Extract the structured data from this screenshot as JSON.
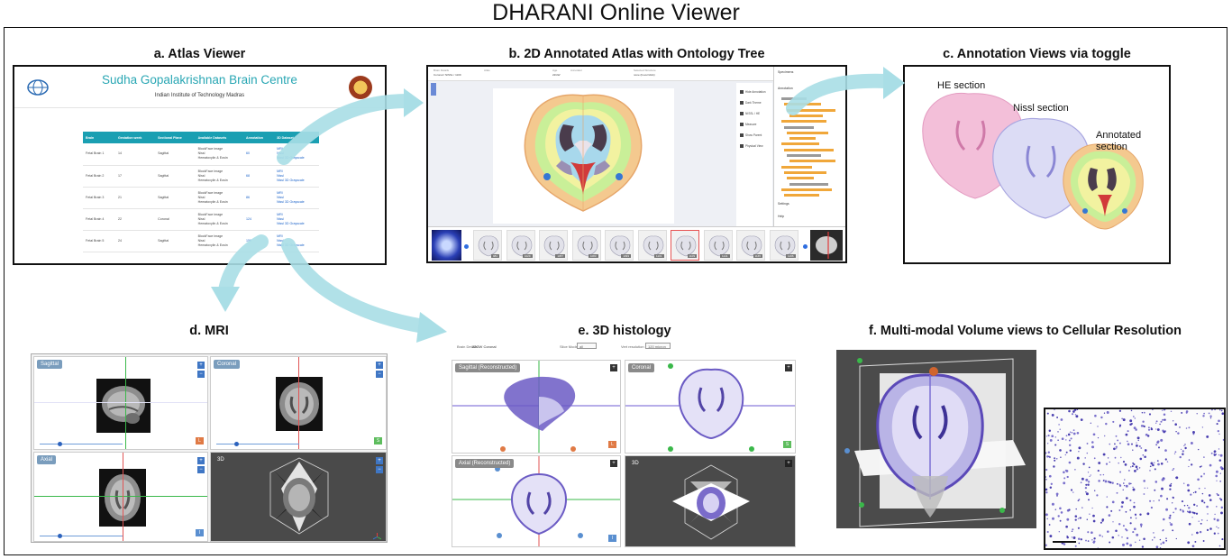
{
  "main_title": "DHARANI Online Viewer",
  "panels": {
    "a": "a. Atlas Viewer",
    "b": "b. 2D Annotated Atlas with Ontology Tree",
    "c": "c. Annotation Views via toggle",
    "d": "d. MRI",
    "e": "e. 3D histology",
    "f": "f. Multi-modal Volume views to Cellular Resolution"
  },
  "atlas": {
    "org_name": "Sudha Gopalakrishnan Brain Centre",
    "institute": "Indian Institute of Technology Madras",
    "headers": [
      "Brain",
      "Gestation week",
      "Sectional Plane",
      "Available Datasets",
      "Annotation",
      "3D Dataset"
    ],
    "rows": [
      {
        "brain": "Fetal Brain 1",
        "week": "14",
        "plane": "Sagittal",
        "datasets": [
          "BlockFace image",
          "Nissl",
          "Hematoxylin & Eosin"
        ],
        "annotation": "60",
        "d3": [
          "MRI",
          "Nissl",
          "Nissl 3D Grayscale"
        ]
      },
      {
        "brain": "Fetal Brain 2",
        "week": "17",
        "plane": "Sagittal",
        "datasets": [
          "BlockFace image",
          "Nissl",
          "Hematoxylin & Eosin"
        ],
        "annotation": "68",
        "d3": [
          "MRI",
          "Nissl",
          "Nissl 3D Grayscale"
        ]
      },
      {
        "brain": "Fetal Brain 3",
        "week": "21",
        "plane": "Sagittal",
        "datasets": [
          "BlockFace image",
          "Nissl",
          "Hematoxylin & Eosin"
        ],
        "annotation": "86",
        "d3": [
          "MRI",
          "Nissl",
          "Nissl 3D Grayscale"
        ]
      },
      {
        "brain": "Fetal Brain 4",
        "week": "22",
        "plane": "Coronal",
        "datasets": [
          "BlockFace image",
          "Nissl",
          "Hematoxylin & Eosin"
        ],
        "annotation": "124",
        "d3": [
          "MRI",
          "Nissl",
          "Nissl 3D Grayscale"
        ]
      },
      {
        "brain": "Fetal Brain 5",
        "week": "24",
        "plane": "Sagittal",
        "datasets": [
          "BlockFace image",
          "Nissl",
          "Hematoxylin & Eosin"
        ],
        "annotation": "150",
        "d3": [
          "MRI",
          "Nissl",
          "Nissl 3D Grayscale"
        ]
      }
    ]
  },
  "atlas2d": {
    "info": [
      "Brain Details",
      "Coronal / NISSL / 1109",
      "Atlas",
      "Age",
      "22GW",
      "Annotator",
      "Selected Structure",
      "none (hover/click)"
    ],
    "tools": [
      "Hide Annotation",
      "Dark Theme",
      "NISSL / HE",
      "Measure",
      "Show Parent",
      "Physical View"
    ],
    "tree_headers": [
      "Specimens",
      "Annotation",
      "Settings",
      "Help"
    ],
    "thumb_numbers": [
      "981",
      "1029",
      "1057",
      "1083",
      "1093",
      "1101",
      "1109",
      "1141",
      "1165",
      "1196"
    ],
    "selected_thumb": "1109"
  },
  "toggle_views": {
    "he": "HE section",
    "nissl": "Nissl section",
    "annotated": "Annotated section"
  },
  "mri": {
    "panes": [
      "Sagittal",
      "Coronal",
      "Axial",
      "3D"
    ],
    "orient_letters": [
      "L",
      "S",
      "I"
    ]
  },
  "histology3d": {
    "header_left": "Brain Details:",
    "header_left_value": "22GW Coronal",
    "header_mid": "Slice Mode",
    "header_mid_value": "all",
    "header_right": "Vert resolution",
    "header_right_value": "120 micron",
    "panes": [
      "Sagittal (Reconstructed)",
      "Coronal",
      "Axial (Reconstructed)",
      "3D"
    ]
  },
  "colors": {
    "arrow": "#a9dee6",
    "atlas_header": "#1a9fb2",
    "org_title": "#2aa7b4",
    "nissl": "#5b49b8",
    "annotation_orange": "#f0a73a",
    "mri_tag": "#7a9dbd"
  }
}
